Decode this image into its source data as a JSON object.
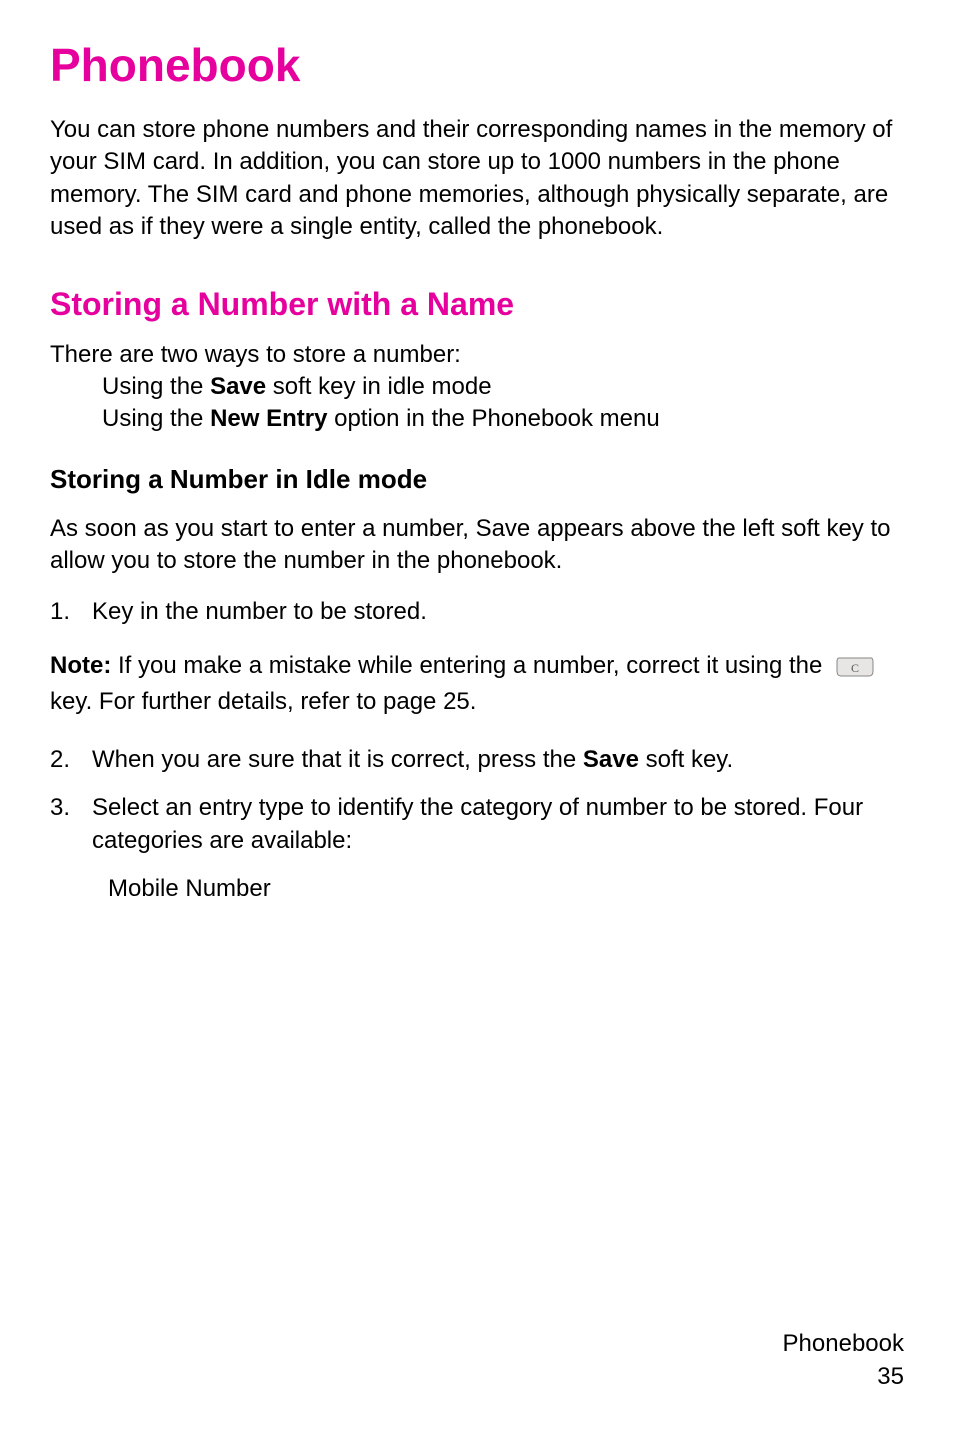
{
  "chapter": {
    "title": "Phonebook"
  },
  "intro": "You can store phone numbers and their corresponding names in the memory of your SIM card. In addition, you can store up to 1000 numbers in the phone memory. The SIM card and phone memories, although physically separate, are used as if they were a single entity, called the phonebook.",
  "section1": {
    "heading": "Storing a Number with a Name",
    "lead": "There are two ways to store a number:",
    "bullet1_pre": "Using the ",
    "bullet1_bold": "Save",
    "bullet1_post": " soft key in idle mode",
    "bullet2_pre": "Using the ",
    "bullet2_bold": "New Entry",
    "bullet2_post": " option in the Phonebook menu"
  },
  "sub1": {
    "heading": "Storing a Number in Idle mode",
    "para": "As soon as you start to enter a number, Save appears above the left soft key to allow you to store the number in the phonebook."
  },
  "steps": {
    "n1": "1.",
    "t1": "Key in the number to be stored.",
    "n2": "2.",
    "t2_pre": "When you are sure that it is correct, press the ",
    "t2_bold": "Save",
    "t2_post": " soft key.",
    "n3": "3.",
    "t3": "Select an entry type to identify the category of number to be stored. Four categories are available:"
  },
  "note": {
    "bold": "Note:",
    "pre": " If you make a mistake while entering a number, correct it using the  ",
    "post": "  key. For further details, refer to page 25."
  },
  "category1": "Mobile Number",
  "footer": {
    "label": "Phonebook",
    "page": "35"
  }
}
